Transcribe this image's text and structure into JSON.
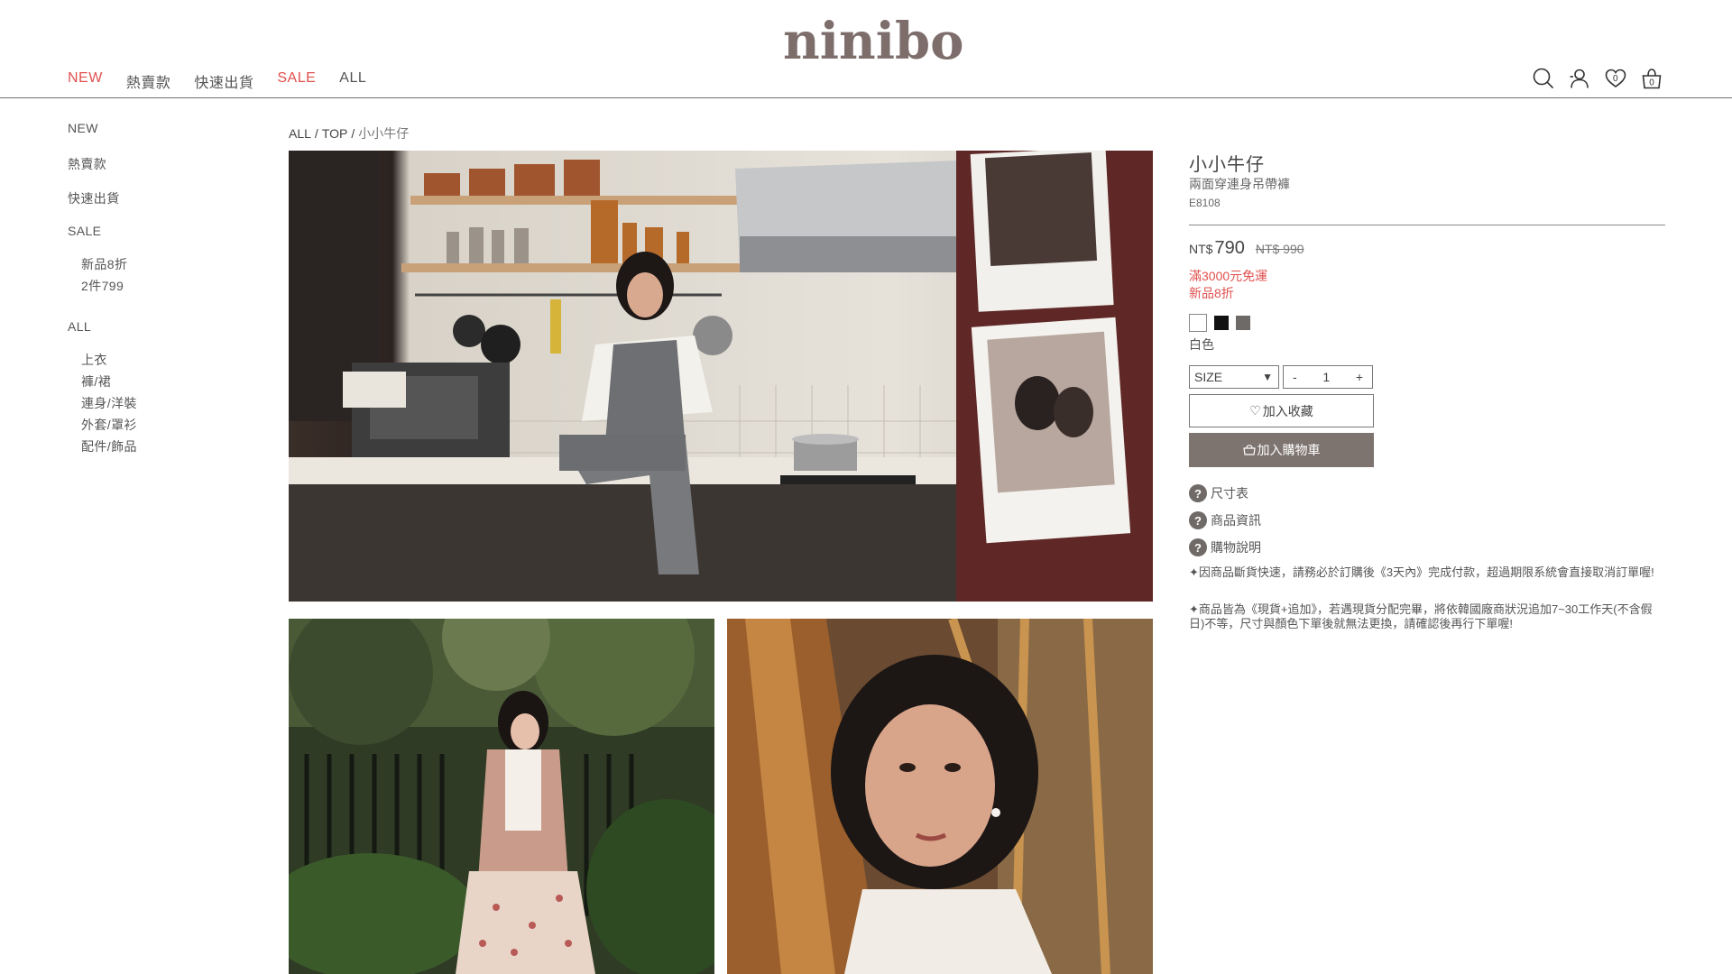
{
  "header": {
    "logo": "ninibo",
    "nav": [
      {
        "label": "NEW",
        "color": "#e0514f"
      },
      {
        "label": "熱賣款",
        "color": "#555555"
      },
      {
        "label": "快速出貨",
        "color": "#555555"
      },
      {
        "label": "SALE",
        "color": "#e0514f"
      },
      {
        "label": "ALL",
        "color": "#555555"
      }
    ],
    "icons": [
      "search-icon",
      "user-icon",
      "wishlist-icon",
      "cart-icon"
    ],
    "wishlist_count": "0",
    "cart_count": "0"
  },
  "sidebar": {
    "new": "NEW",
    "hot": "熱賣款",
    "fast": "快速出貨",
    "sale": "SALE",
    "sale_items": [
      "新品8折",
      "2件799"
    ],
    "all": "ALL",
    "all_items": [
      "上衣",
      "褲/裙",
      "連身/洋裝",
      "外套/罩衫",
      "配件/飾品"
    ]
  },
  "breadcrumb": {
    "items": [
      "ALL",
      "TOP"
    ],
    "current": "小小牛仔",
    "separator": "/"
  },
  "product": {
    "name": "小小牛仔",
    "subtitle": "兩面穿連身吊帶褲",
    "code": "E8108",
    "price_currency": "NT$",
    "price": "790",
    "original_price": "NT$ 990",
    "promos": [
      "滿3000元免運",
      "新品8折"
    ],
    "colors": [
      "#ffffff",
      "#111111",
      "#6e6a68"
    ],
    "selected_color": "白色",
    "size_placeholder": "SIZE",
    "qty_minus": "-",
    "qty_value": "1",
    "qty_plus": "+",
    "fav_label": "加入收藏",
    "cart_label": "加入購物車",
    "help": [
      "尺寸表",
      "商品資訊",
      "購物說明"
    ],
    "notes": [
      "✦因商品斷貨快速，請務必於訂購後《3天內》完成付款，超過期限系統會直接取消訂單喔!",
      "✦商品皆為《現貨+追加》，若遇現貨分配完畢，將依韓國廠商狀況追加7~30工作天(不含假日)不等，尺寸與顏色下單後就無法更換，請確認後再行下單喔!"
    ]
  },
  "accent_colors": {
    "red": "#e0514f",
    "button_bg": "#7d7470",
    "logo": "#7d6e6b"
  }
}
